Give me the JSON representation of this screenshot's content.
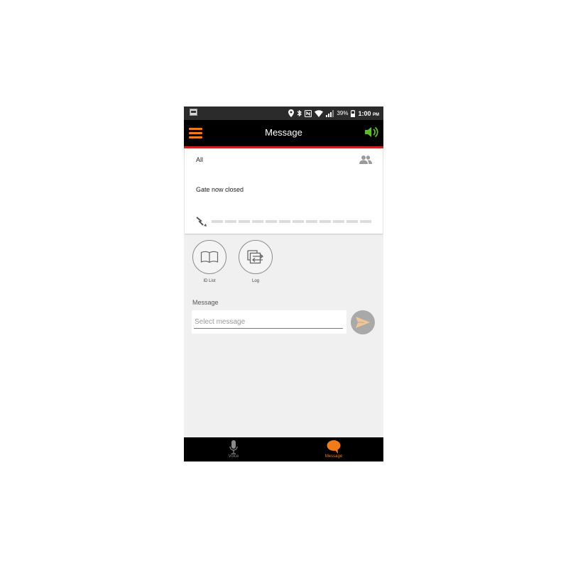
{
  "status_bar": {
    "battery": "39%",
    "time": "1:00",
    "ampm": "PM"
  },
  "app_bar": {
    "title": "Message"
  },
  "card": {
    "recipient": "All",
    "message": "Gate now closed",
    "signal_level": 0
  },
  "actions": {
    "id_list_label": "ID List",
    "log_label": "Log"
  },
  "message_form": {
    "label": "Message",
    "placeholder": "Select message",
    "value": ""
  },
  "bottom_nav": {
    "items": [
      {
        "label": "Voice",
        "icon": "microphone-icon",
        "active": false
      },
      {
        "label": "Message",
        "icon": "speech-bubble-icon",
        "active": true
      }
    ]
  },
  "colors": {
    "accent": "#f07b1a",
    "app_bar_underline": "#d21f1f",
    "speaker": "#5fb832"
  }
}
